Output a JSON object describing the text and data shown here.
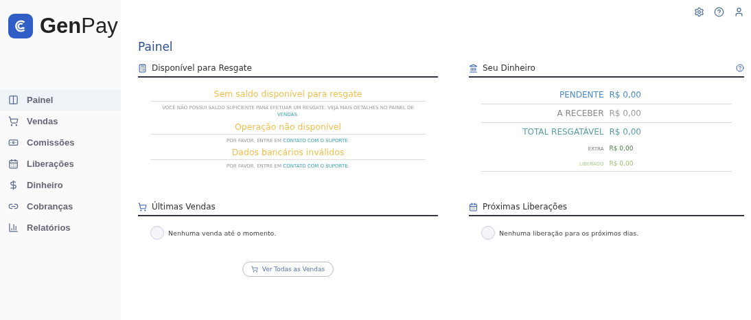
{
  "brand": {
    "first": "Gen",
    "second": "Pay"
  },
  "sidebar": {
    "items": [
      {
        "label": "Painel",
        "selected": true
      },
      {
        "label": "Vendas",
        "selected": false
      },
      {
        "label": "Comissões",
        "selected": false
      },
      {
        "label": "Liberações",
        "selected": false
      },
      {
        "label": "Dinheiro",
        "selected": false
      },
      {
        "label": "Cobranças",
        "selected": false
      },
      {
        "label": "Relatórios",
        "selected": false
      }
    ]
  },
  "page_title": "Painel",
  "available": {
    "title": "Disponível para Resgate",
    "messages": [
      {
        "title": "Sem saldo disponível para resgate",
        "before": "VOCÊ NÃO POSSUI SALDO SUFICIENTE PARA EFETUAR UM RESGATE. VEJA MAIS DETALHES NO PAINEL DE ",
        "link": "VENDAS",
        "after": "."
      },
      {
        "title": "Operação não disponível",
        "before": "POR FAVOR, ENTRE EM ",
        "link": "CONTATO COM O SUPORTE",
        "after": "."
      },
      {
        "title": "Dados bancários inválidos",
        "before": "POR FAVOR, ENTRE EM ",
        "link": "CONTATO COM O SUPORTE",
        "after": "."
      }
    ]
  },
  "money": {
    "title": "Seu Dinheiro",
    "rows": [
      {
        "kind": "pending",
        "label": "PENDENTE",
        "value": "R$ 0,00"
      },
      {
        "kind": "receivable",
        "label": "A RECEBER",
        "value": "R$ 0,00"
      },
      {
        "kind": "total",
        "label": "TOTAL RESGATÁVEL",
        "value": "R$ 0,00"
      },
      {
        "kind": "extra",
        "label": "EXTRA",
        "value": "R$ 0,00"
      },
      {
        "kind": "released",
        "label": "LIBERADO",
        "value": "R$ 0,00"
      }
    ]
  },
  "sales": {
    "title": "Últimas Vendas",
    "empty": "Nenhuma venda até o momento.",
    "button": "Ver Todas as Vendas"
  },
  "releases": {
    "title": "Próximas Liberações",
    "empty": "Nenhuma liberação para os próximos dias."
  }
}
